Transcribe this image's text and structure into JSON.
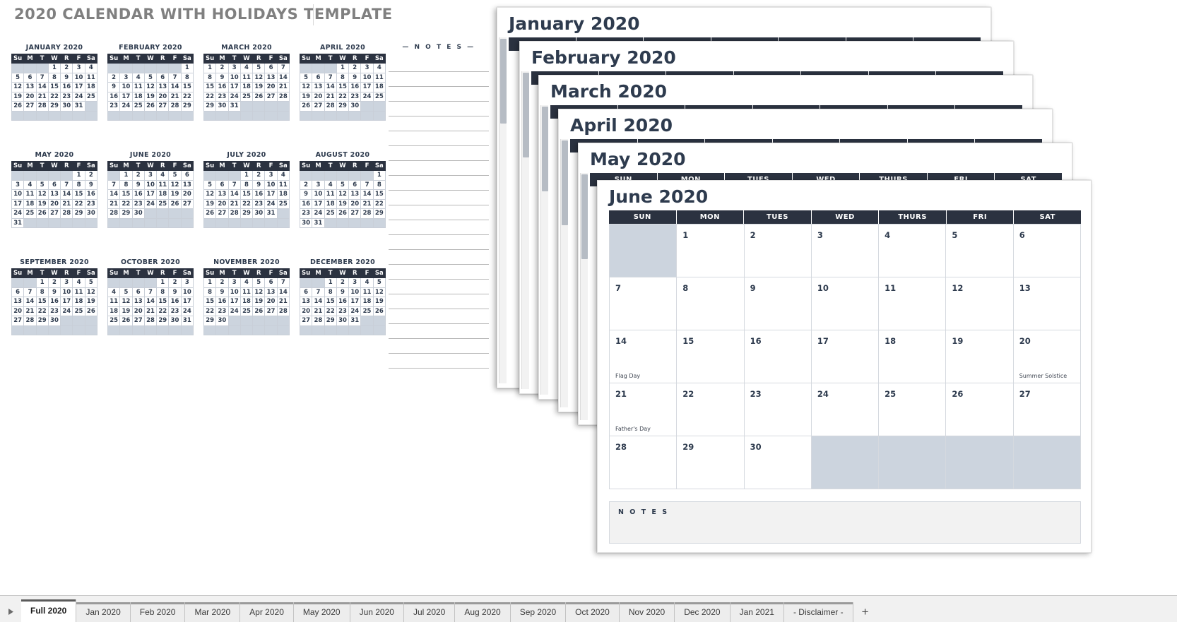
{
  "page_title": "2020 CALENDAR WITH HOLIDAYS TEMPLATE",
  "colors": {
    "header_navy": "#2b3240",
    "blank_cell": "#ccd4de",
    "title_gray": "#808080",
    "text_navy": "#2e3b4e"
  },
  "mini_calendars": {
    "dow_headers": [
      "Su",
      "M",
      "T",
      "W",
      "R",
      "F",
      "Sa"
    ],
    "months": [
      {
        "title": "JANUARY 2020",
        "lead_blank": 3,
        "days": 31
      },
      {
        "title": "FEBRUARY 2020",
        "lead_blank": 6,
        "days": 29
      },
      {
        "title": "MARCH 2020",
        "lead_blank": 0,
        "days": 31
      },
      {
        "title": "APRIL 2020",
        "lead_blank": 3,
        "days": 30
      },
      {
        "title": "MAY 2020",
        "lead_blank": 5,
        "days": 31
      },
      {
        "title": "JUNE 2020",
        "lead_blank": 1,
        "days": 30
      },
      {
        "title": "JULY 2020",
        "lead_blank": 3,
        "days": 31
      },
      {
        "title": "AUGUST 2020",
        "lead_blank": 6,
        "days": 31
      },
      {
        "title": "SEPTEMBER 2020",
        "lead_blank": 2,
        "days": 30
      },
      {
        "title": "OCTOBER 2020",
        "lead_blank": 4,
        "days": 31
      },
      {
        "title": "NOVEMBER 2020",
        "lead_blank": 0,
        "days": 30
      },
      {
        "title": "DECEMBER 2020",
        "lead_blank": 2,
        "days": 31
      }
    ]
  },
  "notes_left": {
    "label": "— N O T E S —",
    "line_count": 21
  },
  "stacked_sheets": [
    {
      "title": "January 2020"
    },
    {
      "title": "February 2020"
    },
    {
      "title": "March 2020"
    },
    {
      "title": "April 2020"
    },
    {
      "title": "May 2020"
    }
  ],
  "month_dow_headers": [
    "SUN",
    "MON",
    "TUES",
    "WED",
    "THURS",
    "FRI",
    "SAT"
  ],
  "june": {
    "title": "June 2020",
    "dow_headers": [
      "SUN",
      "MON",
      "TUES",
      "WED",
      "THURS",
      "FRI",
      "SAT"
    ],
    "lead_blank": 1,
    "days": 30,
    "holidays": {
      "14": "Flag Day",
      "20": "Summer Solstice",
      "21": "Father's Day"
    },
    "notes_label": "N O T E S"
  },
  "tabbar": {
    "scroll_arrow": "scroll-right-icon",
    "active_tab": "Full 2020",
    "tabs": [
      "Full 2020",
      "Jan 2020",
      "Feb 2020",
      "Mar 2020",
      "Apr 2020",
      "May 2020",
      "Jun 2020",
      "Jul 2020",
      "Aug 2020",
      "Sep 2020",
      "Oct 2020",
      "Nov 2020",
      "Dec 2020",
      "Jan 2021",
      "- Disclaimer -"
    ],
    "add_sheet_label": "+"
  }
}
